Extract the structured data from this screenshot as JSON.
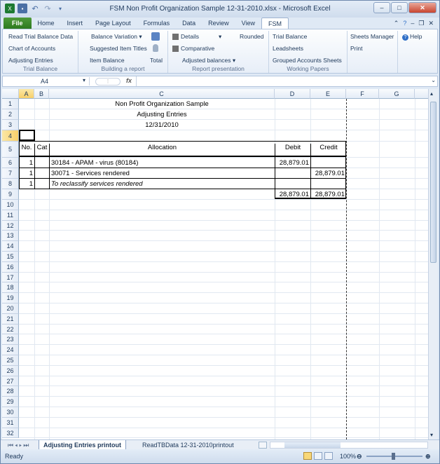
{
  "window": {
    "title": "FSM Non Profit Organization Sample 12-31-2010.xlsx  -  Microsoft Excel"
  },
  "tabs": [
    "File",
    "Home",
    "Insert",
    "Page Layout",
    "Formulas",
    "Data",
    "Review",
    "View",
    "FSM"
  ],
  "ribbon": {
    "trial_balance": {
      "items": [
        "Read Trial Balance Data",
        "Chart of Accounts",
        "Adjusting Entries"
      ],
      "label": "Trial Balance"
    },
    "building": {
      "items": [
        "Balance Variation",
        "Suggested Item Titles",
        "Item Balance",
        "Total"
      ],
      "label": "Building a report"
    },
    "presentation": {
      "items": [
        "Details",
        "Rounded",
        "Comparative",
        "Adjusted balances"
      ],
      "label": "Report presentation"
    },
    "working": {
      "items": [
        "Trial Balance",
        "Leadsheets",
        "Grouped Accounts Sheets"
      ],
      "label": "Working Papers"
    },
    "extra": {
      "items": [
        "Sheets Manager",
        "Print",
        "Help"
      ]
    }
  },
  "formula": {
    "namebox": "A4",
    "fx": "fx"
  },
  "columns": [
    "A",
    "B",
    "C",
    "D",
    "E",
    "F",
    "G"
  ],
  "rows": [
    "1",
    "2",
    "3",
    "4",
    "5",
    "6",
    "7",
    "8",
    "9",
    "10",
    "11",
    "12",
    "13",
    "14",
    "15",
    "16",
    "17",
    "18",
    "19",
    "20",
    "21",
    "22",
    "23",
    "24",
    "25",
    "26",
    "27",
    "28",
    "29",
    "30",
    "31",
    "32"
  ],
  "sheet": {
    "title1": "Non Profit Organization Sample",
    "title2": "Adjusting Entries",
    "title3": "12/31/2010",
    "h_no": "No.",
    "h_cat": "Cat",
    "h_alloc": "Allocation",
    "h_debit": "Debit",
    "h_credit": "Credit",
    "r6_no": "1",
    "r6_alloc": "30184 - APAM - virus (80184)",
    "r6_debit": "28,879.01",
    "r7_no": "1",
    "r7_alloc": "30071 - Services rendered",
    "r7_credit": "28,879.01",
    "r8_no": "1",
    "r8_alloc": "To reclassify services rendered",
    "r9_debit": "28,879.01",
    "r9_credit": "28,879.01"
  },
  "sheet_tabs": [
    "Adjusting Entries printout",
    "ReadTBData 12-31-2010printout"
  ],
  "status": {
    "text": "Ready",
    "zoom": "100%"
  }
}
